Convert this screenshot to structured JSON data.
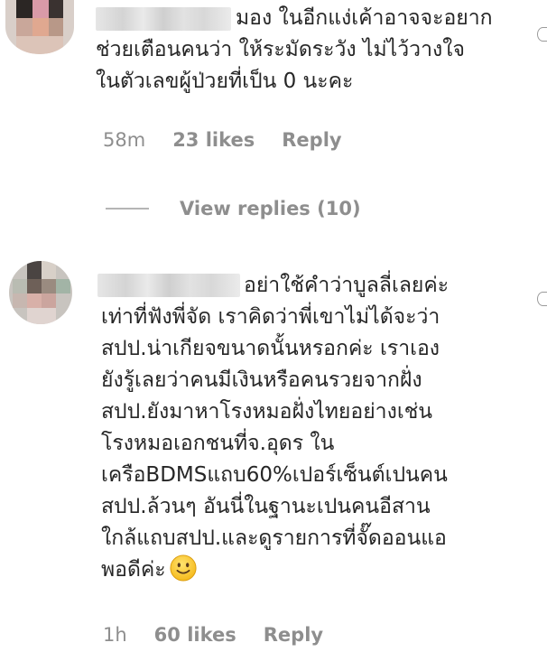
{
  "comments": [
    {
      "text": "มอง ในอีกแง่เค้าอาจจะอยาก\nช่วยเตือนคนว่า ให้ระมัดระวัง ไม่ไว้วางใจ\nในตัวเลขผู้ป่วยที่เป็น 0 นะคะ",
      "time": "58m",
      "likes": "23 likes",
      "reply": "Reply",
      "view_replies": "View replies (10)"
    },
    {
      "text": "อย่าใช้คำว่าบูลลี่เลยค่ะ\nเท่าที่ฟังพี่จัด เราคิดว่าพี่เขาไม่ได้จะว่า\nสปป.น่าเกียจขนาดนั้นหรอกค่ะ เราเอง\nยังรู้เลยว่าคนมีเงินหรือคนรวยจากฝั่ง\nสปป.ยังมาหาโรงหมอฝั่งไทยอย่างเช่น\nโรงหมอเอกชนที่จ.อุดร ใน\nเครือBDMSแถบ60%เปอร์เซ็นต์เปนคน\nสปป.ล้วนๆ อันนี่ในฐานะเปนคนอีสาน\nใกล้แถบสปป.และดูรายการที่จั๊ดออนแอ\nพอดีค่ะ",
      "time": "1h",
      "likes": "60 likes",
      "reply": "Reply"
    }
  ],
  "colors": {
    "text": "#262626",
    "meta": "#8e8e8e",
    "divider": "#b5b5b5"
  },
  "icons": {
    "emoji": "slightly-smiling-face",
    "like": "heart-outline"
  }
}
